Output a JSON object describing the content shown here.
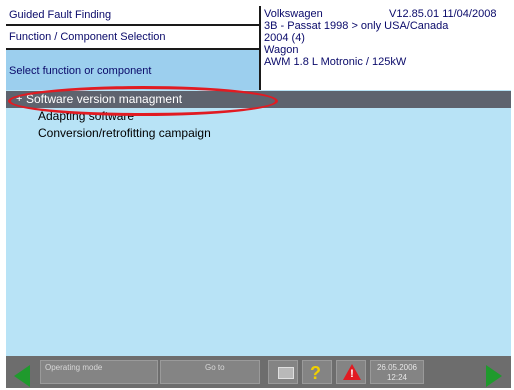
{
  "header": {
    "app_title": "Guided Fault Finding",
    "mode_label": "Function / Component Selection",
    "prompt": "Select function or component",
    "vehicle": {
      "make": "Volkswagen",
      "version": "V12.85.01 11/04/2008",
      "model": "3B - Passat 1998 > only USA/Canada",
      "model_year": "2004 (4)",
      "body": "Wagon",
      "engine": "AWM 1.8 L Motronic / 125kW"
    }
  },
  "list": {
    "items": [
      {
        "label": "Software version managment",
        "selected": true,
        "bullet": "+"
      },
      {
        "label": "Adapting software",
        "selected": false,
        "bullet": ""
      },
      {
        "label": "Conversion/retrofitting campaign",
        "selected": false,
        "bullet": ""
      }
    ]
  },
  "annotation": {
    "color": "#e11b22"
  },
  "footer": {
    "operating_mode_label": "Operating mode",
    "goto_label": "Go to",
    "help_label": "?",
    "warning_label": "!",
    "date": "26.05.2006",
    "time": "12:24"
  },
  "colors": {
    "header_bg": "#ffffff",
    "header_text": "#0a0a6a",
    "prompt_bg": "#9ccfee",
    "list_bg": "#b8e3f6",
    "selected_bg": "#5e636e",
    "toolbar_bg": "#6d6d6d",
    "nav_arrow": "#1f9a2d"
  },
  "icons": {
    "back": "back-arrow-icon",
    "forward": "forward-arrow-icon",
    "print": "printer-icon",
    "help": "help-icon",
    "warning": "warning-icon"
  }
}
